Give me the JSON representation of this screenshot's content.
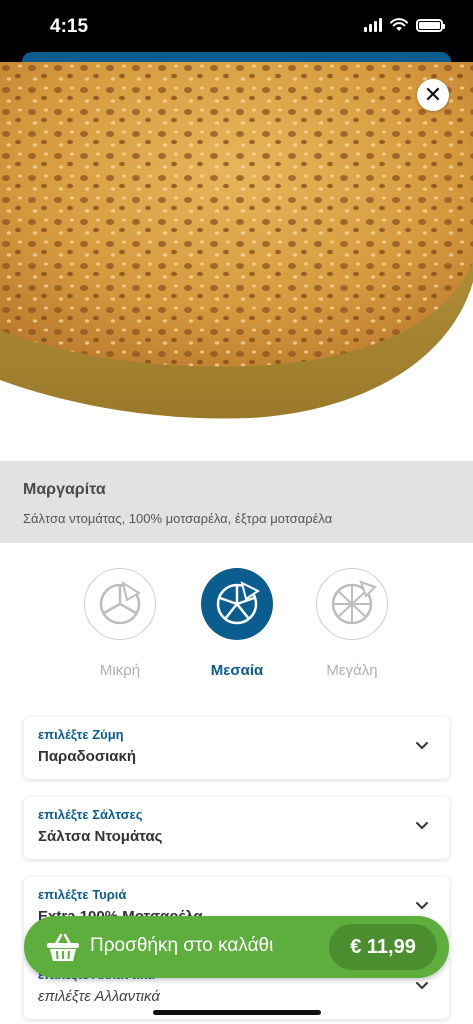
{
  "status_bar": {
    "time": "4:15"
  },
  "icons": {
    "close": "close-icon",
    "basket": "basket-icon",
    "chevron": "chevron-down-icon"
  },
  "colors": {
    "brand_blue": "#0b5c8f",
    "green": "#5eae3e",
    "green_dark": "#4a8e2f",
    "info_bg": "#e2e2e2"
  },
  "product": {
    "name": "Μαργαρίτα",
    "description": "Σάλτσα ντομάτας, 100% μοτσαρέλα, έξτρα μοτσαρέλα"
  },
  "sizes": [
    {
      "label": "Μικρή",
      "selected": false
    },
    {
      "label": "Μεσαία",
      "selected": true
    },
    {
      "label": "Μεγάλη",
      "selected": false
    }
  ],
  "options": [
    {
      "title": "επιλέξτε Ζύμη",
      "value": "Παραδοσιακή"
    },
    {
      "title": "επιλέξτε Σάλτσες",
      "value": "Σάλτσα  Ντομάτας"
    },
    {
      "title": "επιλέξτε Τυριά",
      "value": "Extra 100% Μοτσαρέλα"
    },
    {
      "title": "επιλέξτε Αλλαντικά",
      "value": "επιλέξτε Αλλαντικά"
    }
  ],
  "cart": {
    "label": "Προσθήκη στο καλάθι",
    "price": "€ 11,99"
  }
}
